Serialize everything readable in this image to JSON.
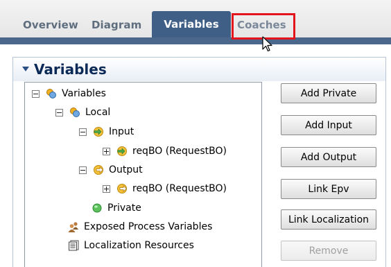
{
  "tabs": [
    {
      "label": "Overview"
    },
    {
      "label": "Diagram"
    },
    {
      "label": "Variables"
    },
    {
      "label": "Coaches"
    }
  ],
  "section": {
    "title": "Variables"
  },
  "tree": {
    "variables": "Variables",
    "local": "Local",
    "input": "Input",
    "input_item": "reqBO (RequestBO)",
    "output": "Output",
    "output_item": "reqBO (RequestBO)",
    "private": "Private",
    "exposed": "Exposed Process Variables",
    "localization": "Localization Resources"
  },
  "buttons": {
    "add_private": "Add Private",
    "add_input": "Add Input",
    "add_output": "Add Output",
    "link_epv": "Link Epv",
    "link_localization": "Link Localization",
    "remove": "Remove"
  },
  "colors": {
    "active_tab": "#3f5f86",
    "highlight": "#e3141c",
    "section_title": "#0b2a57"
  }
}
